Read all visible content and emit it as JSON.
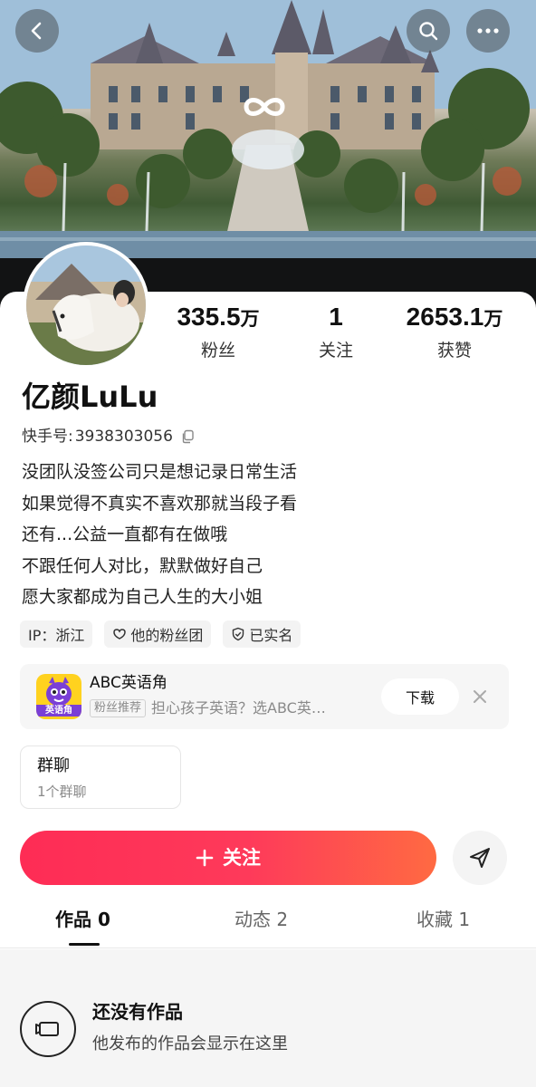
{
  "banner": {
    "back_icon": "chevron-left-icon",
    "search_icon": "search-icon",
    "more_icon": "more-dots-icon",
    "logo_icon": "infinity-icon",
    "scene": "castle-fountain-photo"
  },
  "profile": {
    "avatar": "avatar-photo-white-horse",
    "name": "亿颜LuLu",
    "kuaishou_label": "快手号:",
    "kuaishou_id": "3938303056",
    "copy_icon": "copy-icon",
    "bio": [
      "没团队没签公司只是想记录日常生活",
      "如果觉得不真实不喜欢那就当段子看",
      "还有...公益一直都有在做哦",
      "不跟任何人对比，默默做好自己",
      "愿大家都成为自己人生的大小姐"
    ]
  },
  "stats": {
    "fans": {
      "number": "335.5",
      "unit": "万",
      "label": "粉丝"
    },
    "following": {
      "number": "1",
      "unit": "",
      "label": "关注"
    },
    "likes": {
      "number": "2653.1",
      "unit": "万",
      "label": "获赞"
    }
  },
  "tags": [
    {
      "label": "IP：浙江",
      "icon": ""
    },
    {
      "label": "他的粉丝团",
      "icon": "fan-club-icon"
    },
    {
      "label": "已实名",
      "icon": "verified-shield-icon"
    }
  ],
  "ad": {
    "app_name": "ABC英语角",
    "logo_text": "英语角",
    "badge": "粉丝推荐",
    "description": "担心孩子英语？选ABC英…",
    "download_label": "下载",
    "close_icon": "close-icon"
  },
  "group_chat": {
    "title": "群聊",
    "subtitle": "1个群聊"
  },
  "actions": {
    "follow_label": "关注",
    "plus_icon": "plus-icon",
    "share_icon": "send-icon"
  },
  "tabs": [
    {
      "label": "作品 0",
      "active": true
    },
    {
      "label": "动态 2",
      "active": false
    },
    {
      "label": "收藏 1",
      "active": false
    }
  ],
  "empty_state": {
    "icon": "video-camera-icon",
    "title": "还没有作品",
    "subtitle": "他发布的作品会显示在这里"
  },
  "colors": {
    "follow_gradient_start": "#fe2c55",
    "follow_gradient_end": "#ff6a42",
    "text_primary": "#111111",
    "text_secondary": "#8a8a8a"
  }
}
